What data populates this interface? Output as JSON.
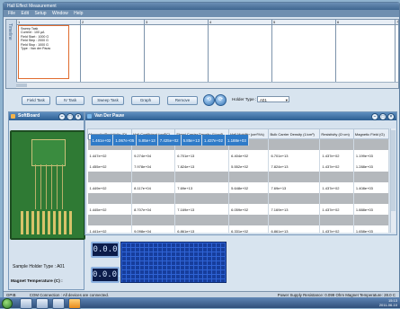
{
  "window": {
    "title": "Hall Effect Measurement"
  },
  "menu": [
    "File",
    "Edit",
    "Setup",
    "Window",
    "Help"
  ],
  "timeline": {
    "side_label": "Timeline",
    "ticks": [
      "1",
      "2",
      "3",
      "4",
      "5",
      "6",
      "7"
    ],
    "block_lines": [
      "Sweep Task",
      "Current : 100 µA",
      "Field Start : 1000 G",
      "Field Step : 2000 G",
      "Field Stop : 1000 G",
      "Type : Van der Pauw"
    ]
  },
  "toolbar": {
    "buttons": [
      "Field Task",
      "IV Task",
      "Sweep Task",
      "Graph",
      "Remove"
    ],
    "holder_label": "Holder Type :",
    "holder_value": "A01"
  },
  "left_panel": {
    "title": "SoftBoard",
    "holder_label": "Sample Holder Type : A01",
    "temp_label": "Magnet Temperature (C) :",
    "digits_top": "0.0.0",
    "digits_bottom": "0.0.0.0"
  },
  "table": {
    "title": "Van Der Pauw",
    "columns": [
      "Magnetic Resistivity (Ω)",
      "Hall Coefficient (cm³/C)",
      "Sheet Carrier Density (1/cm²)",
      "Hall Mobility (cm²/Vs)",
      "Bulk Carrier Density (1/cm³)",
      "Resistivity (Ω·cm)",
      "Magnetic Field (G)"
    ],
    "rows": [
      {
        "style": "gray",
        "cells": [
          "",
          "",
          "",
          "",
          "",
          "",
          ""
        ]
      },
      {
        "style": "plain",
        "cells": [
          "1.447e+02",
          "9.274e+04",
          "6.701e+13",
          "6.404e+02",
          "6.701e+13",
          "1.437e+02",
          "1.199e+03"
        ]
      },
      {
        "style": "sel",
        "cells": [
          "1.461e+02",
          "1.067e+05",
          "5.85e+13",
          "7.425e+02",
          "5.85e+13",
          "1.437e+02",
          "1.188e+03"
        ]
      },
      {
        "style": "plain",
        "cells": [
          "1.455e+02",
          "7.978e+04",
          "7.824e+13",
          "5.552e+02",
          "7.824e+13",
          "1.437e+02",
          "1.288e+03"
        ]
      },
      {
        "style": "gray",
        "cells": [
          "",
          "",
          "",
          "",
          "",
          "",
          ""
        ]
      },
      {
        "style": "plain",
        "cells": [
          "1.449e+02",
          "8.117e+04",
          "7.69e+13",
          "5.648e+02",
          "7.69e+13",
          "1.437e+02",
          "1.408e+03"
        ]
      },
      {
        "style": "gray",
        "cells": [
          "",
          "",
          "",
          "",
          "",
          "",
          ""
        ]
      },
      {
        "style": "plain",
        "cells": [
          "1.445e+02",
          "8.707e+04",
          "7.169e+13",
          "6.059e+02",
          "7.169e+13",
          "1.437e+02",
          "1.888e+03"
        ]
      },
      {
        "style": "gray",
        "cells": [
          "",
          "",
          "",
          "",
          "",
          "",
          ""
        ]
      },
      {
        "style": "plain",
        "cells": [
          "1.441e+02",
          "9.098e+04",
          "6.861e+13",
          "6.331e+02",
          "6.861e+13",
          "1.437e+02",
          "1.658e+03"
        ]
      }
    ]
  },
  "status": {
    "left_tag": "GPIB",
    "message": "COM  Connection : All devices are connected.",
    "right": "Power Supply Resistance: 0.099 Ohm  Magnet Temperature: 28.0 C"
  },
  "taskbar": {
    "time": "15:13",
    "date": "2011-06-10"
  }
}
